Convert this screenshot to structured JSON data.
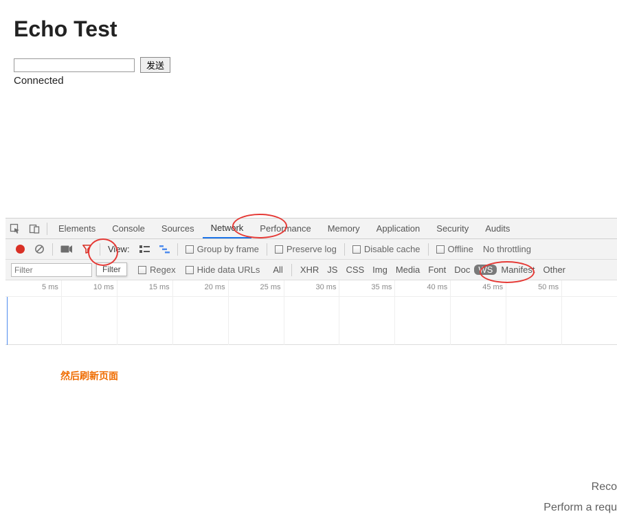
{
  "page": {
    "title": "Echo Test",
    "input_value": "",
    "send_label": "发送",
    "status": "Connected"
  },
  "devtools": {
    "tabs": [
      "Elements",
      "Console",
      "Sources",
      "Network",
      "Performance",
      "Memory",
      "Application",
      "Security",
      "Audits"
    ],
    "active_tab": "Network"
  },
  "network_toolbar": {
    "icons": {
      "record": "record-icon",
      "clear": "clear-icon",
      "camera": "camera-icon",
      "filter": "filter-icon"
    },
    "view_label": "View:",
    "group_by_frame": "Group by frame",
    "preserve_log": "Preserve log",
    "disable_cache": "Disable cache",
    "offline": "Offline",
    "throttling": "No throttling"
  },
  "filter_row": {
    "filter_placeholder": "Filter",
    "filter_tooltip": "Filter",
    "regex": "Regex",
    "hide_data_urls": "Hide data URLs",
    "types": [
      "All",
      "XHR",
      "JS",
      "CSS",
      "Img",
      "Media",
      "Font",
      "Doc",
      "WS",
      "Manifest",
      "Other"
    ],
    "selected_type": "WS"
  },
  "timeline": {
    "ticks": [
      "5 ms",
      "10 ms",
      "15 ms",
      "20 ms",
      "25 ms",
      "30 ms",
      "35 ms",
      "40 ms",
      "45 ms",
      "50 ms"
    ]
  },
  "annotations": {
    "chinese": "然后刷新页面",
    "cutoff1": "Reco",
    "cutoff2": "Perform a requ"
  }
}
